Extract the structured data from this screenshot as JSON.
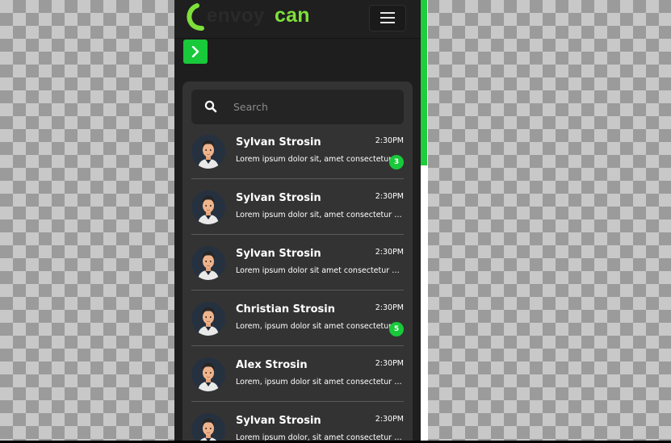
{
  "header": {
    "logo_ghost_text": "envoy",
    "logo_text": "can",
    "accent": "#7ee03a",
    "menu_icon": "hamburger-icon"
  },
  "sidebar_toggle": {
    "icon": "chevron-right-icon",
    "color": "#18c93a"
  },
  "search": {
    "placeholder": "Search",
    "value": "",
    "icon": "search-icon"
  },
  "chats": [
    {
      "name": "Sylvan Strosin",
      "time": "2:30PM",
      "message": "Lorem ipsum dolor sit, amet consectetur adipisicing elit.",
      "unread": "3"
    },
    {
      "name": "Sylvan Strosin",
      "time": "2:30PM",
      "message": "Lorem ipsum dolor sit, amet consectetur adipisicing elit.",
      "unread": ""
    },
    {
      "name": "Sylvan Strosin",
      "time": "2:30PM",
      "message": "Lorem ipsum dolor sit amet consectetur adipisicing elit.",
      "unread": ""
    },
    {
      "name": "Christian Strosin",
      "time": "2:30PM",
      "message": "Lorem, ipsum dolor sit amet consectetur adipisicing elit.",
      "unread": "5"
    },
    {
      "name": "Alex Strosin",
      "time": "2:30PM",
      "message": "Lorem, ipsum dolor sit amet consectetur adipisicing elit.",
      "unread": ""
    },
    {
      "name": "Sylvan Strosin",
      "time": "2:30PM",
      "message": "Lorem ipsum dolor, sit amet consectetur adipisicing elit.",
      "unread": ""
    }
  ],
  "colors": {
    "badge": "#18c93a",
    "scrollbar": "#1fce3c",
    "panel": "#333333"
  }
}
